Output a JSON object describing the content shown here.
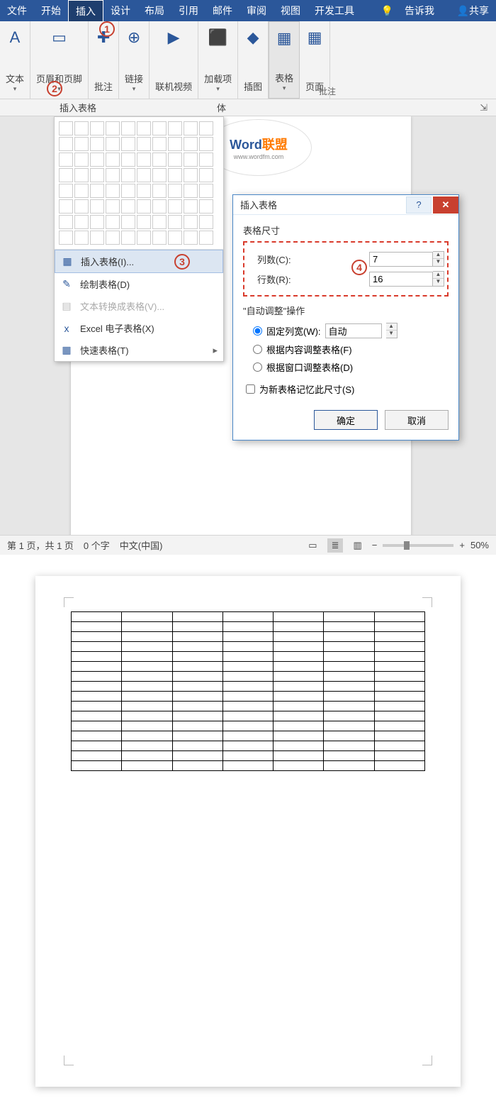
{
  "menu": {
    "tabs": [
      "文件",
      "开始",
      "插入",
      "设计",
      "布局",
      "引用",
      "邮件",
      "审阅",
      "视图",
      "开发工具"
    ],
    "activeIndex": 2,
    "tell_me": "告诉我",
    "share": "共享"
  },
  "ribbon": {
    "groups": [
      {
        "label": "页面",
        "icon": "▦"
      },
      {
        "label": "表格",
        "icon": "▦",
        "drop": true,
        "selected": true
      },
      {
        "label": "插图",
        "icon": "◆"
      },
      {
        "label": "加载项",
        "icon": "⬛",
        "drop": true
      },
      {
        "label": "联机视频",
        "icon": "▶"
      },
      {
        "label": "链接",
        "icon": "⊕",
        "drop": true
      },
      {
        "label": "批注",
        "icon": "✚"
      },
      {
        "label": "页眉和页脚",
        "icon": "▭",
        "drop": true
      },
      {
        "label": "文本",
        "icon": "A",
        "drop": true
      }
    ],
    "section_label": "批注",
    "font_caption": "体"
  },
  "table_dropdown": {
    "title": "插入表格",
    "items": [
      {
        "label": "插入表格(I)...",
        "icon": "▦",
        "selected": true
      },
      {
        "label": "绘制表格(D)",
        "icon": "✎"
      },
      {
        "label": "文本转换成表格(V)...",
        "icon": "▤",
        "disabled": true
      },
      {
        "label": "Excel 电子表格(X)",
        "icon": "x"
      },
      {
        "label": "快速表格(T)",
        "icon": "▦",
        "arrow": true
      }
    ]
  },
  "dialog": {
    "title": "插入表格",
    "size_label": "表格尺寸",
    "cols_label": "列数(C):",
    "cols_value": "7",
    "rows_label": "行数(R):",
    "rows_value": "16",
    "autofit_label": "\"自动调整\"操作",
    "fixed_label": "固定列宽(W):",
    "fixed_value": "自动",
    "fit_content": "根据内容调整表格(F)",
    "fit_window": "根据窗口调整表格(D)",
    "remember": "为新表格记忆此尺寸(S)",
    "ok": "确定",
    "cancel": "取消"
  },
  "watermark": {
    "w1": "Word",
    "w2": "联盟",
    "w3": "www.wordfm.com"
  },
  "callouts": {
    "c1": "1",
    "c2": "2",
    "c3": "3",
    "c4": "4"
  },
  "status": {
    "page": "第 1 页，共 1 页",
    "words": "0 个字",
    "lang": "中文(中国)",
    "zoom": "50%"
  },
  "result": {
    "cols": 7,
    "rows": 16
  }
}
